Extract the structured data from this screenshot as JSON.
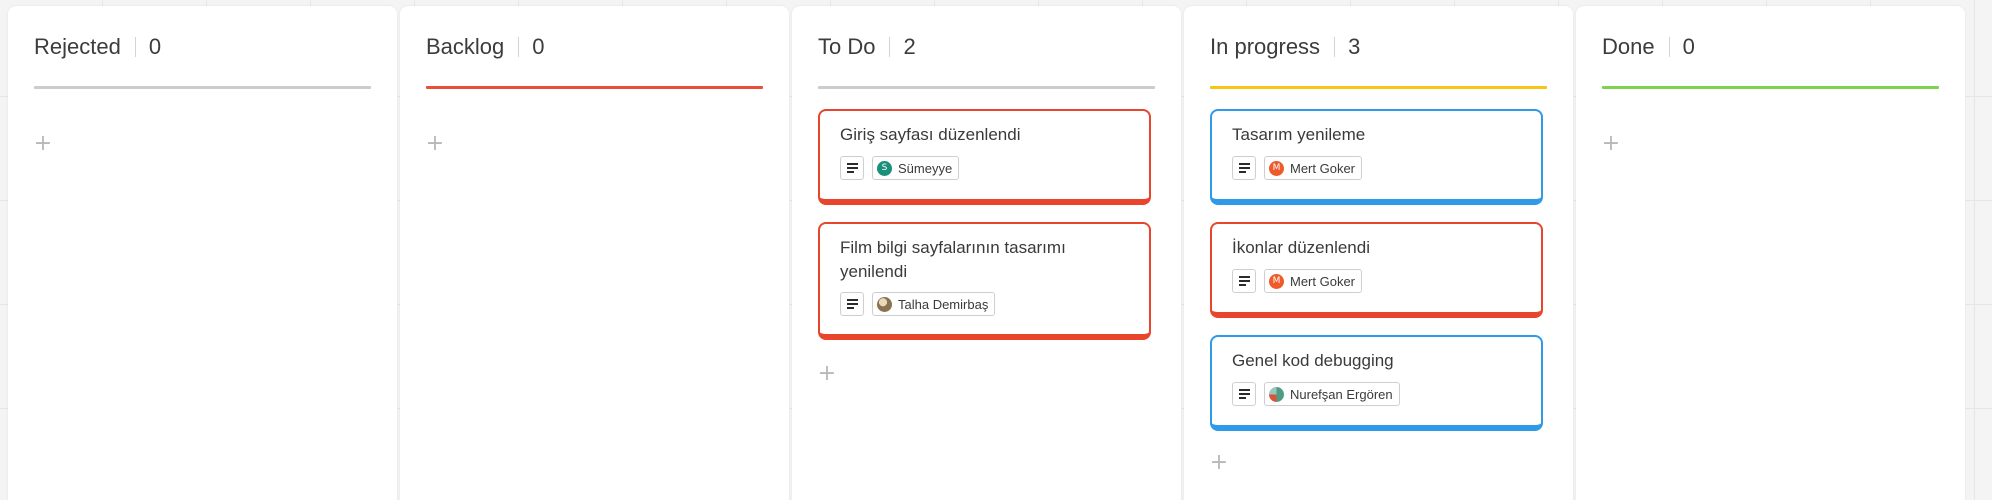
{
  "columns": [
    {
      "name": "Rejected",
      "count": "0",
      "color": "#cccccc"
    },
    {
      "name": "Backlog",
      "count": "0",
      "color": "#e8503a"
    },
    {
      "name": "To Do",
      "count": "2",
      "color": "#cccccc"
    },
    {
      "name": "In progress",
      "count": "3",
      "color": "#f5c518"
    },
    {
      "name": "Done",
      "count": "0",
      "color": "#7ed24f"
    }
  ],
  "cards": {
    "todo": [
      {
        "title": "Giriş sayfası düzenlendi",
        "assignee": "Sümeyye",
        "avatar_letter": "S",
        "avatar_color": "#1a8f7a",
        "border_color": "#e8452c"
      },
      {
        "title": "Film bilgi sayfalarının tasarımı yenilendi",
        "assignee": "Talha Demirbaş",
        "avatar_letter": "",
        "avatar_color": "#b59a6a",
        "border_color": "#e8452c"
      }
    ],
    "in_progress": [
      {
        "title": "Tasarım yenileme",
        "assignee": "Mert Goker",
        "avatar_letter": "M",
        "avatar_color": "#ef5a2a",
        "border_color": "#2f9be8"
      },
      {
        "title": "İkonlar düzenlendi",
        "assignee": "Mert Goker",
        "avatar_letter": "M",
        "avatar_color": "#ef5a2a",
        "border_color": "#e8452c"
      },
      {
        "title": "Genel kod debugging",
        "assignee": "Nurefşan Ergören",
        "avatar_letter": "",
        "avatar_color": "#5a8f7a",
        "border_color": "#2f9be8"
      }
    ]
  },
  "add_icon": "plus-icon",
  "description_icon": "description-lines-icon"
}
